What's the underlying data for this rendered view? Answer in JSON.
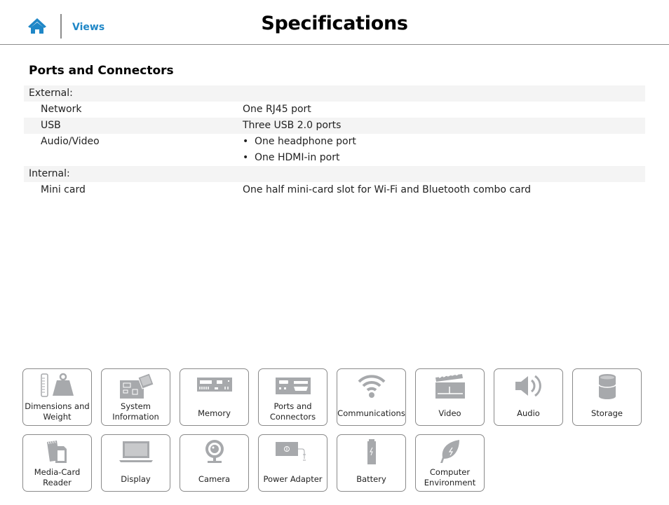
{
  "header": {
    "home_icon": "home-icon",
    "views_label": "Views",
    "title": "Specifications",
    "accent_color": "#1f87c7"
  },
  "section": {
    "title": "Ports and Connectors",
    "rows": [
      {
        "type": "group",
        "key": "External:"
      },
      {
        "type": "item",
        "key": "Network",
        "value": "One RJ45 port"
      },
      {
        "type": "item",
        "key": "USB",
        "value": "Three USB 2.0 ports"
      },
      {
        "type": "bullets",
        "key": "Audio/Video",
        "values": [
          "One headphone port",
          "One HDMI-in port"
        ]
      },
      {
        "type": "group",
        "key": "Internal:"
      },
      {
        "type": "item",
        "key": "Mini card",
        "value": "One half mini-card slot for Wi-Fi and Bluetooth combo card"
      }
    ],
    "bullet_char": "•"
  },
  "tiles": [
    {
      "label": "Dimensions and Weight",
      "icon": "dimensions-weight-icon"
    },
    {
      "label": "System Information",
      "icon": "system-board-icon"
    },
    {
      "label": "Memory",
      "icon": "memory-module-icon"
    },
    {
      "label": "Ports and Connectors",
      "icon": "ports-icon"
    },
    {
      "label": "Communications",
      "icon": "wifi-icon"
    },
    {
      "label": "Video",
      "icon": "clapperboard-icon"
    },
    {
      "label": "Audio",
      "icon": "speaker-icon"
    },
    {
      "label": "Storage",
      "icon": "storage-cylinder-icon"
    },
    {
      "label": "Media-Card Reader",
      "icon": "media-card-icon"
    },
    {
      "label": "Display",
      "icon": "laptop-display-icon"
    },
    {
      "label": "Camera",
      "icon": "webcam-icon"
    },
    {
      "label": "Power Adapter",
      "icon": "power-adapter-icon"
    },
    {
      "label": "Battery",
      "icon": "battery-icon"
    },
    {
      "label": "Computer Environment",
      "icon": "leaf-icon"
    }
  ]
}
